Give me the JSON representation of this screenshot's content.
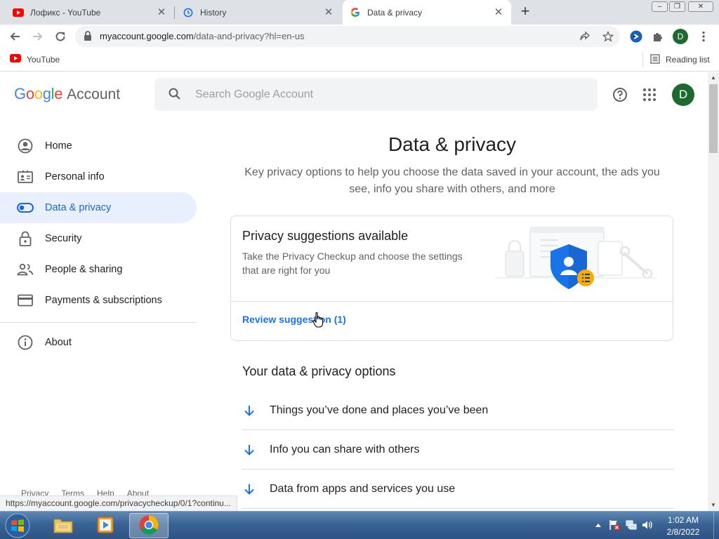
{
  "browser": {
    "tabs": [
      {
        "title": "Лофикс - YouTube",
        "favicon": "youtube-icon"
      },
      {
        "title": "History",
        "favicon": "history-icon"
      },
      {
        "title": "Data & privacy",
        "favicon": "google-g-icon",
        "active": true
      }
    ],
    "new_tab": "+",
    "url_host": "myaccount.google.com",
    "url_path": "/data-and-privacy?hl=en-us",
    "profile_initial": "D",
    "bookmarks": [
      {
        "label": "YouTube",
        "icon": "youtube-icon"
      }
    ],
    "reading_list": "Reading list"
  },
  "header": {
    "logo_google": "Google",
    "logo_account": "Account",
    "search_placeholder": "Search Google Account",
    "avatar_initial": "D"
  },
  "sidebar": {
    "items": [
      {
        "label": "Home",
        "icon": "account-circle-icon"
      },
      {
        "label": "Personal info",
        "icon": "id-card-icon"
      },
      {
        "label": "Data & privacy",
        "icon": "toggle-icon",
        "active": true
      },
      {
        "label": "Security",
        "icon": "lock-icon"
      },
      {
        "label": "People & sharing",
        "icon": "people-icon"
      },
      {
        "label": "Payments & subscriptions",
        "icon": "credit-card-icon"
      }
    ],
    "about": {
      "label": "About",
      "icon": "info-icon"
    },
    "footer": [
      "Privacy",
      "Terms",
      "Help",
      "About"
    ]
  },
  "main": {
    "title": "Data & privacy",
    "subtitle": "Key privacy options to help you choose the data saved in your account, the ads you see, info you share with others, and more",
    "card": {
      "title": "Privacy suggestions available",
      "description": "Take the Privacy Checkup and choose the settings that are right for you",
      "link": "Review suggestion (1)"
    },
    "options_title": "Your data & privacy options",
    "options": [
      "Things you’ve done and places you’ve been",
      "Info you can share with others",
      "Data from apps and services you use"
    ]
  },
  "status_url": "https://myaccount.google.com/privacycheckup/0/1?continu...",
  "taskbar": {
    "time": "1:02 AM",
    "date": "2/8/2022"
  },
  "colors": {
    "accent": "#1a73e8",
    "active_nav_bg": "#e8f0fe",
    "avatar_bg": "#1e6a2e",
    "taskbar": "#3a6495"
  }
}
